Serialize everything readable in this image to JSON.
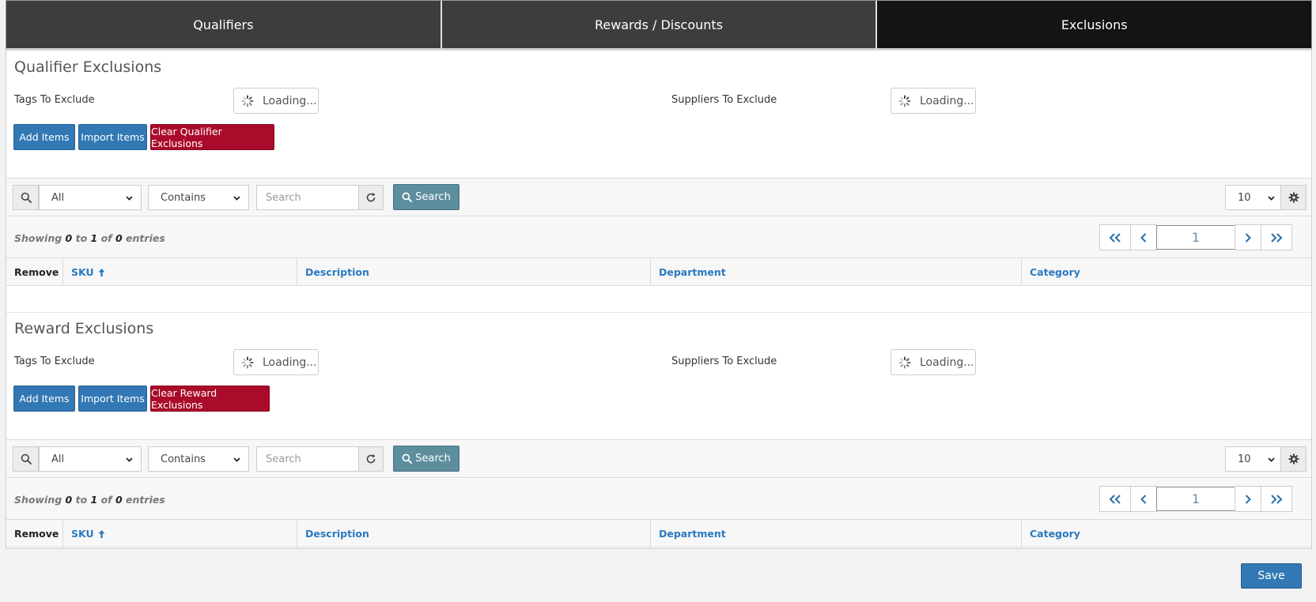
{
  "tabs": [
    {
      "label": "Qualifiers"
    },
    {
      "label": "Rewards / Discounts"
    },
    {
      "label": "Exclusions"
    }
  ],
  "active_tab": "Exclusions",
  "qualifier": {
    "title": "Qualifier Exclusions",
    "tags_label": "Tags To Exclude",
    "tags_loading": "Loading...",
    "suppliers_label": "Suppliers To Exclude",
    "suppliers_loading": "Loading...",
    "add_items": "Add Items",
    "import_items": "Import Items",
    "clear": "Clear Qualifier Exclusions",
    "filter_field": "All",
    "filter_op": "Contains",
    "search_placeholder": "Search",
    "search_button": "Search",
    "page_size": "10",
    "showing_prefix": "Showing",
    "showing_from": "0",
    "showing_to_word": "to",
    "showing_to": "1",
    "showing_of_word": "of",
    "showing_total": "0",
    "showing_suffix": "entries",
    "current_page": "1",
    "columns": [
      "Remove",
      "SKU",
      "Description",
      "Department",
      "Category"
    ]
  },
  "reward": {
    "title": "Reward Exclusions",
    "tags_label": "Tags To Exclude",
    "tags_loading": "Loading...",
    "suppliers_label": "Suppliers To Exclude",
    "suppliers_loading": "Loading...",
    "add_items": "Add Items",
    "import_items": "Import Items",
    "clear": "Clear Reward Exclusions",
    "filter_field": "All",
    "filter_op": "Contains",
    "search_placeholder": "Search",
    "search_button": "Search",
    "page_size": "10",
    "showing_prefix": "Showing",
    "showing_from": "0",
    "showing_to_word": "to",
    "showing_to": "1",
    "showing_of_word": "of",
    "showing_total": "0",
    "showing_suffix": "entries",
    "current_page": "1",
    "columns": [
      "Remove",
      "SKU",
      "Description",
      "Department",
      "Category"
    ]
  },
  "footer": {
    "save_label": "Save"
  },
  "colors": {
    "tab_bg": "#3d3d3d",
    "tab_active_bg": "#141414",
    "primary": "#3178b4",
    "danger": "#ab0b2a",
    "search_btn": "#5d8e9e",
    "link": "#2a7ac0"
  },
  "icons": {
    "spinner": "spinner-icon",
    "search": "search-icon",
    "refresh": "refresh-icon",
    "gear": "gear-icon",
    "sort_up": "arrow-up-icon",
    "first": "double-chevron-left-icon",
    "prev": "chevron-left-icon",
    "next": "chevron-right-icon",
    "last": "double-chevron-right-icon",
    "dropdown": "chevron-down-icon"
  }
}
